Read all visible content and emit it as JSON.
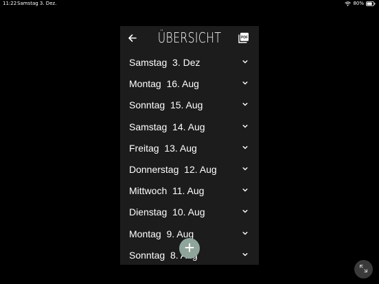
{
  "status_bar": {
    "time": "11:22",
    "date": "Samstag 3. Dez.",
    "battery": "80%",
    "battery_level": 0.8
  },
  "header": {
    "title": "ÜBERSICHT",
    "back_icon": "arrow-left-icon",
    "pdf_icon": "pdf-icon",
    "pdf_label": "PDF"
  },
  "days": [
    {
      "label": "Samstag  3. Dez"
    },
    {
      "label": "Montag  16. Aug"
    },
    {
      "label": "Sonntag  15. Aug"
    },
    {
      "label": "Samstag  14. Aug"
    },
    {
      "label": "Freitag  13. Aug"
    },
    {
      "label": "Donnerstag  12. Aug"
    },
    {
      "label": "Mittwoch  11. Aug"
    },
    {
      "label": "Dienstag  10. Aug"
    },
    {
      "label": "Montag  9. Aug"
    },
    {
      "label": "Sonntag  8. Aug"
    }
  ],
  "colors": {
    "background": "#000000",
    "panel": "#1c1c1c",
    "fab": "#8fa59b",
    "text": "#ffffff"
  },
  "fab": {
    "icon": "plus-icon"
  },
  "resize": {
    "icon": "resize-icon"
  }
}
